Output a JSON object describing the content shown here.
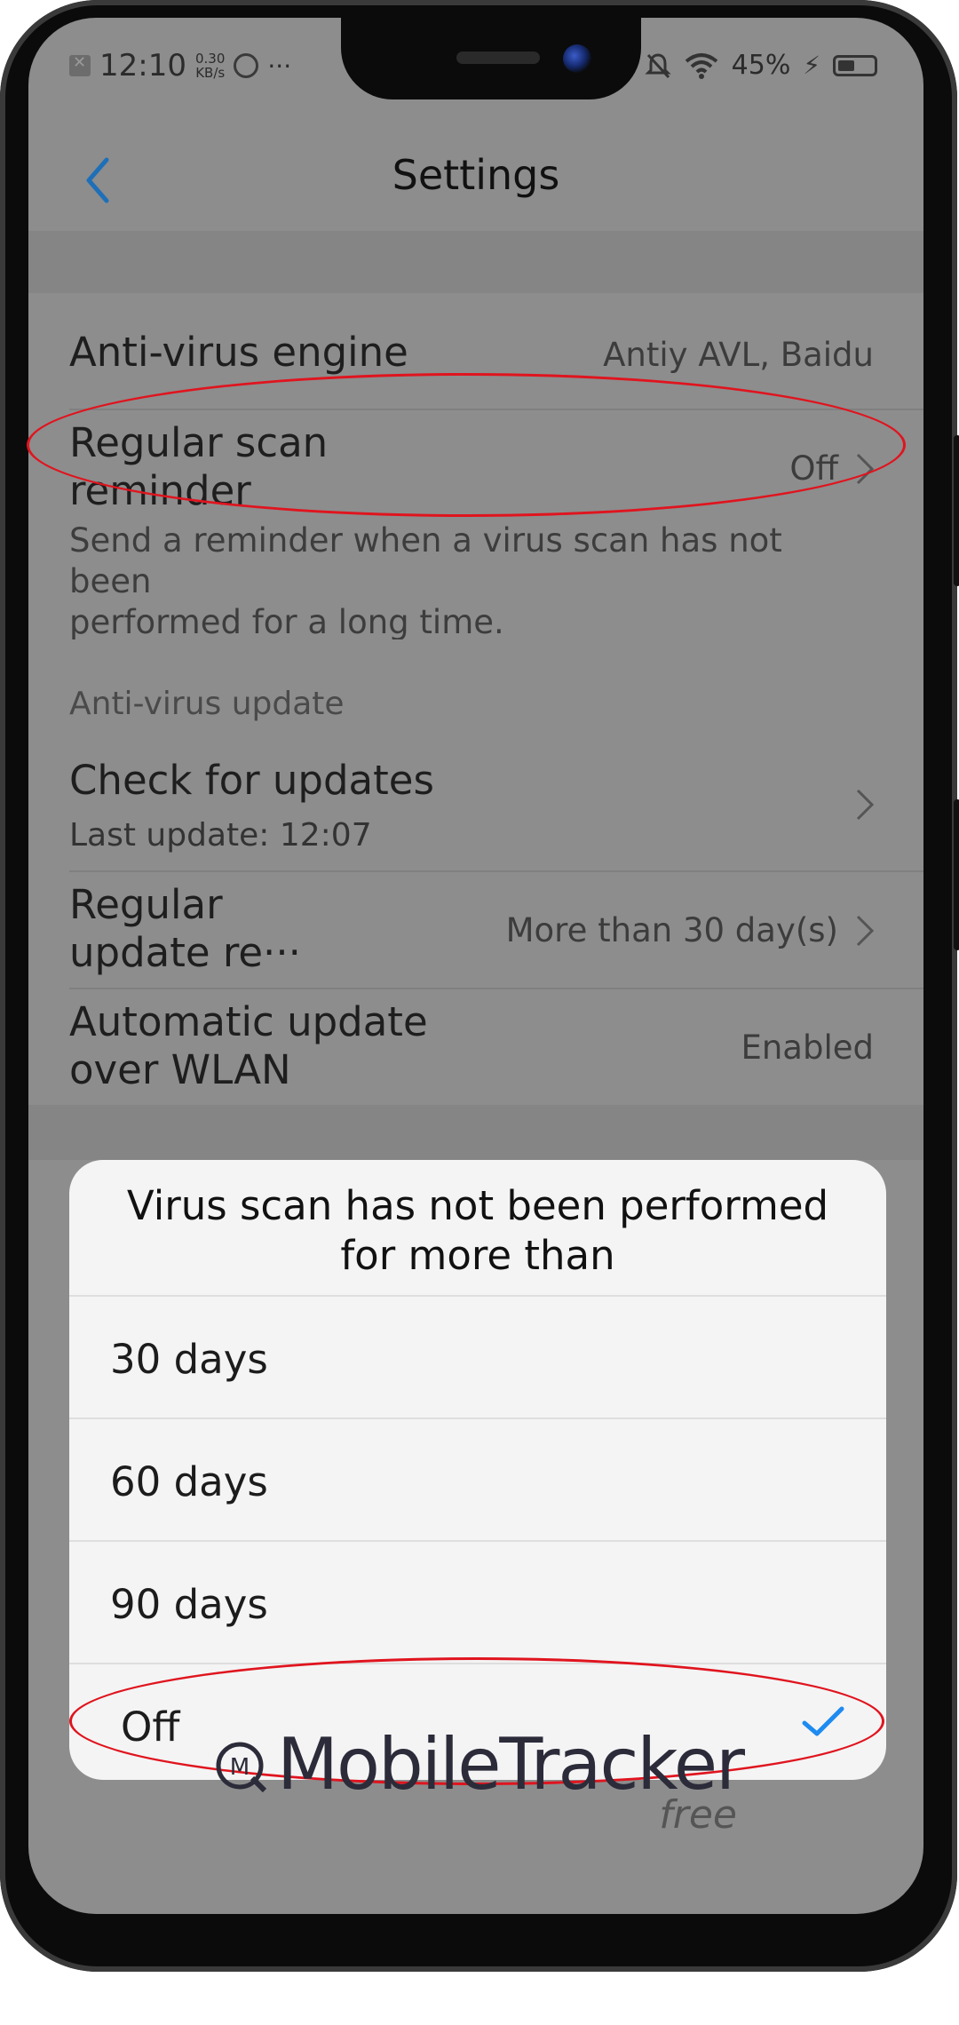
{
  "status_bar": {
    "time": "12:10",
    "speed_value": "0.30",
    "speed_unit": "KB/s",
    "more": "···",
    "battery": "45%"
  },
  "header": {
    "title": "Settings",
    "back_icon": "chevron-left-icon"
  },
  "settings": {
    "antivirus_engine": {
      "label": "Anti-virus engine",
      "value": "Antiy AVL, Baidu"
    },
    "regular_scan": {
      "label_line1": "Regular scan",
      "label_line2": "reminder",
      "value": "Off",
      "description_line1": "Send a reminder when a virus scan has not been",
      "description_line2": "performed for a long time."
    },
    "update_section_header": "Anti-virus update",
    "check_updates": {
      "label": "Check for updates",
      "sub": "Last update: 12:07"
    },
    "regular_update": {
      "label_line1": "Regular",
      "label_line2": "update re···",
      "value": "More than 30 day(s)"
    },
    "automatic_update": {
      "label_line1": "Automatic update",
      "label_line2": "over WLAN",
      "value": "Enabled"
    }
  },
  "dialog": {
    "title_line1": "Virus scan has not been performed",
    "title_line2": "for more than",
    "options": [
      "30 days",
      "60 days",
      "90 days",
      "Off"
    ],
    "selected": "Off"
  },
  "watermark": {
    "brand": "MobileTracker",
    "tag": "free"
  },
  "colors": {
    "accent": "#1e8bf0",
    "annotation": "#e0141e",
    "overlay_bg": "#8d8d8d",
    "dialog_bg": "#f4f4f4"
  }
}
